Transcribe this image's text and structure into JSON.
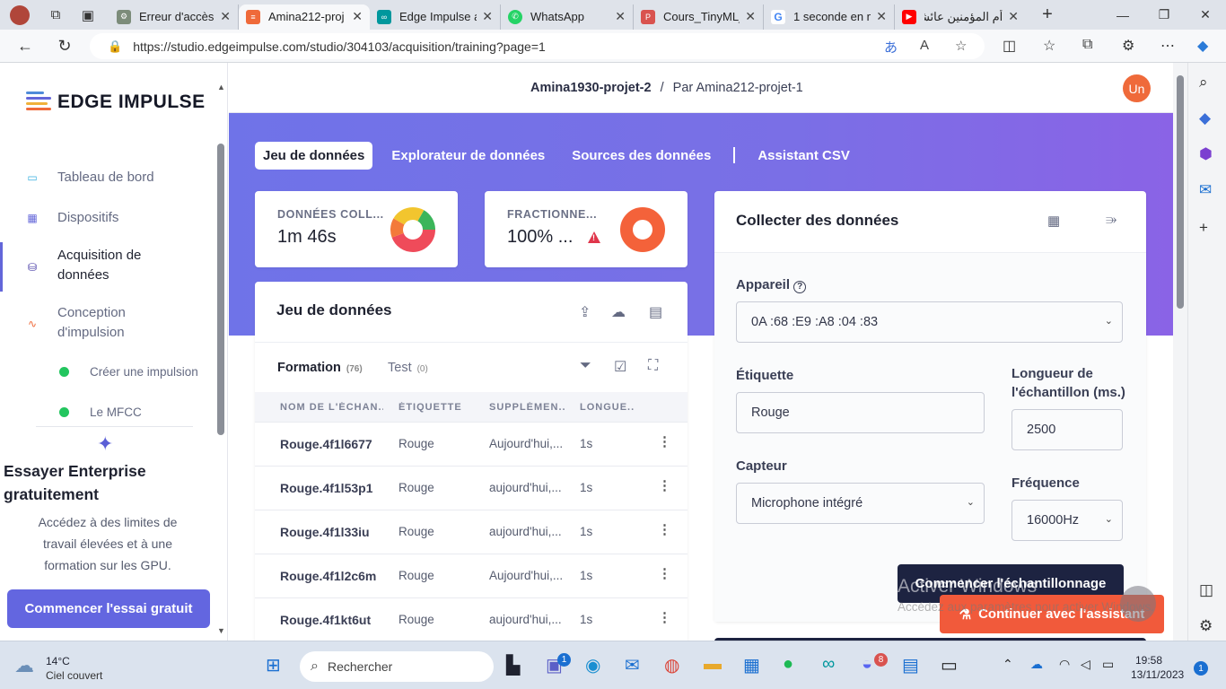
{
  "browser": {
    "tabs": [
      {
        "title": "Erreur d'accès a",
        "icon": "gear-icon",
        "color": "#7c8c7a"
      },
      {
        "title": "Amina212-proj",
        "icon": "edge-impulse-icon",
        "color": "#ef6a3a"
      },
      {
        "title": "Edge Impulse a",
        "icon": "arduino-icon",
        "color": "#00979d"
      },
      {
        "title": "WhatsApp",
        "icon": "whatsapp-icon",
        "color": "#25d366"
      },
      {
        "title": "Cours_TinyML_",
        "icon": "pdf-icon",
        "color": "#d9534f"
      },
      {
        "title": "1 seconde en m",
        "icon": "google-icon",
        "color": "#4285f4"
      },
      {
        "title": "أم المؤمنين عائشة",
        "icon": "youtube-icon",
        "color": "#ff0000"
      }
    ],
    "new_tab": "+",
    "url": "https://studio.edgeimpulse.com/studio/304103/acquisition/training?page=1"
  },
  "sidebar": {
    "logo": "EDGE IMPULSE",
    "items": [
      {
        "label": "Tableau de bord",
        "icon": "monitor-icon"
      },
      {
        "label": "Dispositifs",
        "icon": "chip-icon"
      },
      {
        "label": "Acquisition de données",
        "icon": "database-icon"
      },
      {
        "label": "Conception d'impulsion",
        "icon": "pulse-icon"
      }
    ],
    "subitems": [
      {
        "label": "Créer une impulsion"
      },
      {
        "label": "Le MFCC"
      }
    ],
    "enterprise": {
      "title": "Essayer Enterprise gratuitement",
      "desc": "Accédez à des limites de travail élevées et à une formation sur les GPU.",
      "button": "Commencer l'essai gratuit"
    }
  },
  "header": {
    "project": "Amina1930-projet-2",
    "separator": "/",
    "owner": "Par Amina212-projet-1",
    "avatar": "Un"
  },
  "subtabs": [
    "Jeu de données",
    "Explorateur de données",
    "Sources des données",
    "Assistant CSV"
  ],
  "kpis": [
    {
      "label": "DONNÉES COLL...",
      "value": "1m 46s"
    },
    {
      "label": "FRACTIONNE...",
      "value": "100% ...",
      "warning": "!"
    }
  ],
  "dataset": {
    "title": "Jeu de données",
    "tabs": [
      {
        "label": "Formation",
        "count": "(76)"
      },
      {
        "label": "Test",
        "count": "(0)"
      }
    ],
    "columns": [
      "NOM DE L'ÉCHAN...",
      "ÉTIQUETTE",
      "SUPPLÉMEN...",
      "LONGUE..."
    ],
    "rows": [
      {
        "name": "Rouge.4f1l6677",
        "label": "Rouge",
        "added": "Aujourd'hui,...",
        "length": "1s"
      },
      {
        "name": "Rouge.4f1l53p1",
        "label": "Rouge",
        "added": "aujourd'hui,...",
        "length": "1s"
      },
      {
        "name": "Rouge.4f1l33iu",
        "label": "Rouge",
        "added": "aujourd'hui,...",
        "length": "1s"
      },
      {
        "name": "Rouge.4f1l2c6m",
        "label": "Rouge",
        "added": "Aujourd'hui,...",
        "length": "1s"
      },
      {
        "name": "Rouge.4f1kt6ut",
        "label": "Rouge",
        "added": "aujourd'hui,...",
        "length": "1s"
      }
    ]
  },
  "collect": {
    "title": "Collecter des données",
    "device_label": "Appareil",
    "device_value": "0A :68 :E9 :A8 :04 :83",
    "label_label": "Étiquette",
    "label_value": "Rouge",
    "length_label": "Longueur de l'échantillon (ms.)",
    "length_value": "2500",
    "sensor_label": "Capteur",
    "sensor_value": "Microphone intégré",
    "freq_label": "Fréquence",
    "freq_value": "16000Hz",
    "start_button": "Commencer l'échantillonnage"
  },
  "assistant_button": "Continuer avec l'assistant",
  "watermark": {
    "line1": "Activer Windows",
    "line2": "Accédez aux paramètres pour activer Windows."
  },
  "taskbar": {
    "weather_temp": "14°C",
    "weather_desc": "Ciel couvert",
    "search_placeholder": "Rechercher",
    "time": "19:58",
    "date": "13/11/2023",
    "notif": "1",
    "teams_badge": "1",
    "discord_badge": "8"
  }
}
